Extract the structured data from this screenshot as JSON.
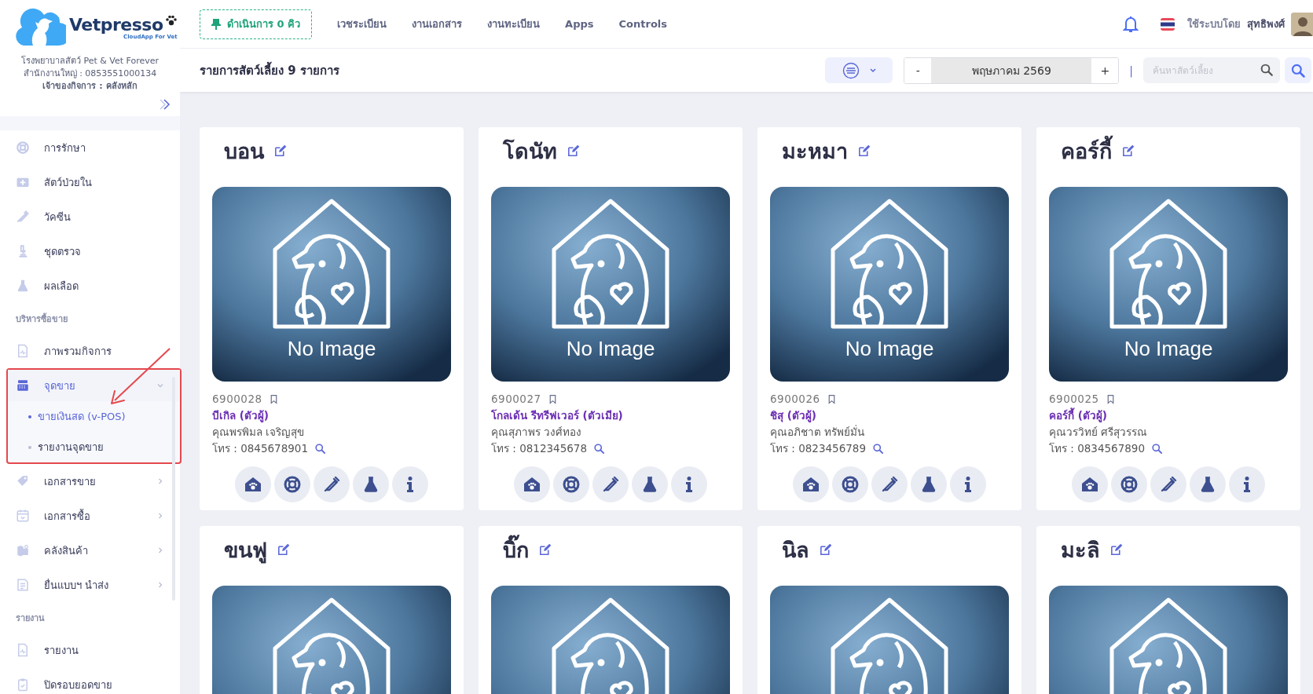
{
  "sidebar": {
    "logo": {
      "name": "Vetpresso",
      "tagline": "CloudApp For Vet"
    },
    "clinic_name": "โรงพยาบาลสัตว์ Pet & Vet Forever",
    "head_office": "สำนักงานใหญ่ : 0853551000134",
    "owner": "เจ้าของกิจการ : คลังหลัก",
    "items": [
      {
        "kind": "link",
        "label": "การรักษา",
        "selected": false
      },
      {
        "kind": "link",
        "label": "สัตว์ป่วยใน",
        "selected": false
      },
      {
        "kind": "link",
        "label": "วัคซีน",
        "selected": false
      },
      {
        "kind": "link",
        "label": "ชุดตรวจ",
        "selected": false
      },
      {
        "kind": "link",
        "label": "ผลเลือด",
        "selected": false
      },
      {
        "kind": "section",
        "label": "บริหารซื้อขาย"
      },
      {
        "kind": "link",
        "label": "ภาพรวมกิจการ",
        "selected": false
      },
      {
        "kind": "group",
        "label": "จุดขาย",
        "selected": true,
        "expanded": true,
        "annotated": true,
        "children": [
          {
            "label": "ขายเงินสด (v-POS)",
            "selected": true
          },
          {
            "label": "รายงานจุดขาย",
            "selected": false
          }
        ]
      },
      {
        "kind": "group",
        "label": "เอกสารขาย",
        "selected": false,
        "expanded": false,
        "annotated": false
      },
      {
        "kind": "group",
        "label": "เอกสารซื้อ",
        "selected": false,
        "expanded": false,
        "annotated": false
      },
      {
        "kind": "group",
        "label": "คลังสินค้า",
        "selected": false,
        "expanded": false,
        "annotated": false
      },
      {
        "kind": "group",
        "label": "ยื่นแบบฯ นำส่ง",
        "selected": false,
        "expanded": false,
        "annotated": false
      },
      {
        "kind": "section",
        "label": "รายงาน"
      },
      {
        "kind": "link",
        "label": "รายงาน",
        "selected": false
      },
      {
        "kind": "link",
        "label": "ปิดรอบยอดขาย",
        "selected": false
      }
    ]
  },
  "topbar": {
    "queue_button": "ดำเนินการ 0 คิว",
    "menu": [
      "เวชระเบียน",
      "งานเอกสาร",
      "งานทะเบียน",
      "Apps",
      "Controls"
    ],
    "user_prefix": "ใช้ระบบโดย",
    "user_name": "สุทธิพงศ์"
  },
  "toolbar": {
    "title": "รายการสัตว์เลี้ยง 9 รายการ",
    "decrement": "-",
    "month": "พฤษภาคม 2569",
    "increment": "+",
    "separator": "|",
    "search": {
      "placeholder": "ค้นหาสัตว์เลี้ยง"
    }
  },
  "pets": [
    {
      "name": "บอน",
      "image_label": "No Image",
      "code": "6900028",
      "breed": "บีเกิล (ตัวผู้)",
      "owner": "คุณพรพิมล เจริญสุข",
      "phone": "โทร : 0845678901"
    },
    {
      "name": "โดนัท",
      "image_label": "No Image",
      "code": "6900027",
      "breed": "โกลเด้น รีทรีฟเวอร์ (ตัวเมีย)",
      "owner": "คุณสุภาพร วงศ์ทอง",
      "phone": "โทร : 0812345678"
    },
    {
      "name": "มะหมา",
      "image_label": "No Image",
      "code": "6900026",
      "breed": "ชิสุ (ตัวผู้)",
      "owner": "คุณอภิชาต ทรัพย์มั่น",
      "phone": "โทร : 0823456789"
    },
    {
      "name": "คอร์กี้",
      "image_label": "No Image",
      "code": "6900025",
      "breed": "คอร์กี้ (ตัวผู้)",
      "owner": "คุณวรวิทย์ ศรีสุวรรณ",
      "phone": "โทร : 0834567890"
    },
    {
      "name": "ขนฟู"
    },
    {
      "name": "บิ๊ก"
    },
    {
      "name": "นิล"
    },
    {
      "name": "มะลิ"
    }
  ]
}
